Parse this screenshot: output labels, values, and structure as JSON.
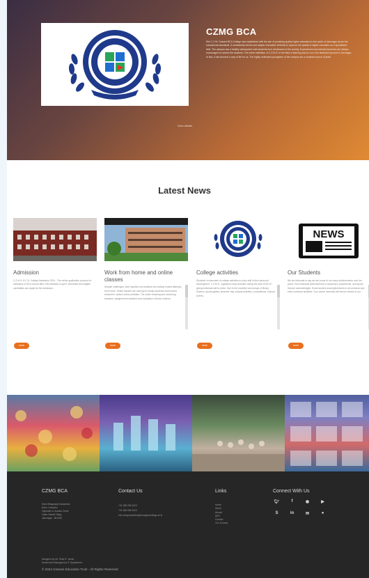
{
  "hero": {
    "title": "CZMG BCA",
    "text": "Shri C.Z.M. Gosrani BCA College was established with the aim of providing quality higher education to the youth of Jamnagar as per the educational standards. It consistently strives and adopts innovative methods to improve the quality of higher education as a specialised field. The campus has a healthy atmosphere with students from all streams of the society. Experienced and talented teachers are always encouraged to nurture the students. The entire institution of C.Z.M.G. in the field of learning and so on is the distinctive growth of Jamnagar. In fact, it has become a way of life for us. The highly motivated youngsters of the campus are a constant source of pride.",
    "link": "View details",
    "logo": {
      "ring_top": "C.Z.M.GOSRANI B.C.A. COLLEGE",
      "since": "SINCE 2005",
      "ribbon": "Gosrani - Jamnagar"
    }
  },
  "news": {
    "heading": "Latest News",
    "cards": [
      {
        "title": "Admission",
        "text": "C.Z.M.G. B.C.A. College Admission 2024 - The online application process for admission in BCA course after 12th standard is open. Interested and eligible candidates can apply for the admission.",
        "button": "more"
      },
      {
        "title": "Work from home and online classes",
        "text": "Despite challenges, both faculties and students are making honest attempts from home. Online classes are running for faculty students and lectures transmit in various online activities. The online teaching and mentoring sessions, assignment evaluation and evaluation of tests continue.",
        "button": "more"
      },
      {
        "title": "College activities",
        "text": "Students' involvement in college activities is a key skill in their personal development. C.Z.M.G. organises many activities during the year 2019-20 giving individual skill to shine. Due to the excellent and unique of library, Science, sports gallery, students' day, cultural activities, competitions, cultural events.",
        "button": "more"
      },
      {
        "title": "Our Students",
        "text": "We are fortunate to say we are proud of our many achievements over the years, from individual achievements in academics, placements, and sports that are acknowledged. Some student accomplishments in all curricular and extra curricular activities. Your career, interests will forever remain in our.",
        "button": "more"
      }
    ],
    "news_icon_label": "NEWS"
  },
  "footer": {
    "col1_heading": "CZMG BCA",
    "address": [
      "Shah Bhagwanji Karsandas",
      "Educ. Complex,",
      "Opposite to Gowani Circle,",
      "Indira Gandhi Marg,",
      "Jamnagar - 361008"
    ],
    "col2_heading": "Contact Us",
    "phones": [
      "+91 288 255 3423",
      "+91 288 255 3424"
    ],
    "email": "info.czmgosranibca@czmgbcacollege.ac.in",
    "col3_heading": "Links",
    "links": [
      "Home",
      "About",
      "Alumni",
      "NEP",
      "Contact",
      "Our Journey"
    ],
    "col4_heading": "Connect With Us",
    "social": [
      "twitter-icon",
      "facebook-icon",
      "instagram-icon",
      "youtube-icon",
      "skype-icon",
      "linkedin-icon",
      "email-icon",
      "flickr-icon"
    ],
    "small_lines": [
      "Designed by Mr. Pinal R. Vansh",
      "Hosted and Managed by IT Department"
    ],
    "copyright": "© 2024 Gosrani Education Trust - All Rights Reserved"
  },
  "colors": {
    "accent": "#e8701e",
    "hero_start": "#3a2d43",
    "hero_end": "#e08a33",
    "footer": "#262626"
  }
}
